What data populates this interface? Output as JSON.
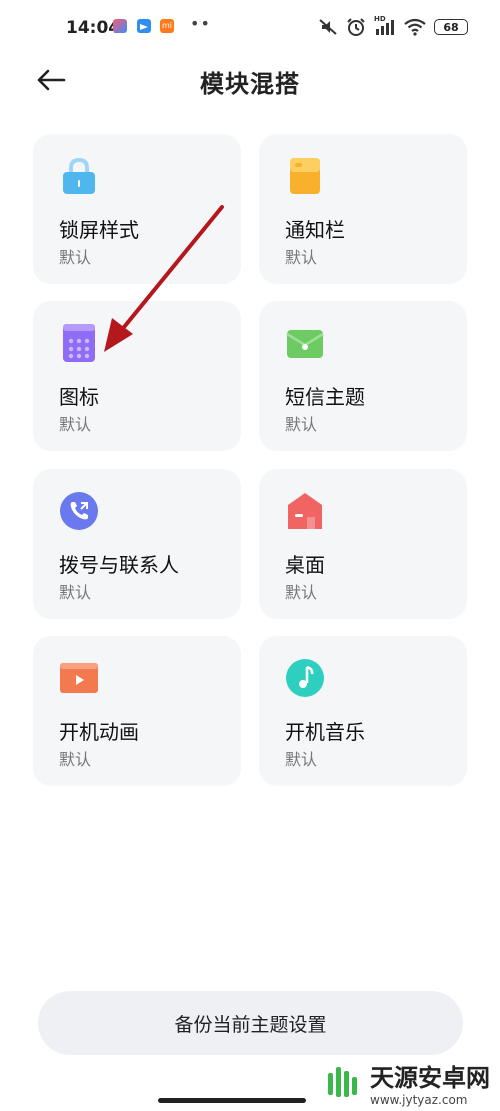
{
  "status_bar": {
    "time": "14:04",
    "battery": "68",
    "hd_label": "HD",
    "app_badge": "mi"
  },
  "header": {
    "title": "模块混搭",
    "back_icon": "back-arrow-icon"
  },
  "cards": [
    {
      "title": "锁屏样式",
      "subtitle": "默认",
      "icon": "lock-icon",
      "color": "#4fb6ee"
    },
    {
      "title": "通知栏",
      "subtitle": "默认",
      "icon": "notification-icon",
      "color": "#f8b02d"
    },
    {
      "title": "图标",
      "subtitle": "默认",
      "icon": "icon-grid-icon",
      "color": "#8f6cf5"
    },
    {
      "title": "短信主题",
      "subtitle": "默认",
      "icon": "message-envelope-icon",
      "color": "#6ecb63"
    },
    {
      "title": "拨号与联系人",
      "subtitle": "默认",
      "icon": "phone-call-icon",
      "color": "#6a79ee"
    },
    {
      "title": "桌面",
      "subtitle": "默认",
      "icon": "home-icon",
      "color": "#f06464"
    },
    {
      "title": "开机动画",
      "subtitle": "默认",
      "icon": "video-play-icon",
      "color": "#f37a4e"
    },
    {
      "title": "开机音乐",
      "subtitle": "默认",
      "icon": "music-note-icon",
      "color": "#2fcfc0"
    }
  ],
  "footer": {
    "backup_button": "备份当前主题设置"
  },
  "watermark": {
    "title": "天源安卓网",
    "url": "www.jytyaz.com"
  },
  "annotation": {
    "arrow_color": "#b5171e"
  }
}
